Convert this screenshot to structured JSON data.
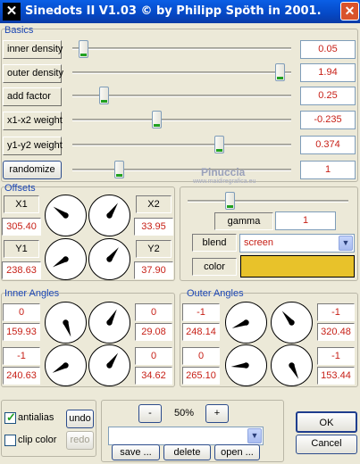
{
  "window": {
    "title": "Sinedots II V1.03 © by Philipp Spöth in 2001.",
    "close_glyph": "✕",
    "app_icon_glyph": "✕"
  },
  "basics": {
    "title": "Basics",
    "sliders": [
      {
        "label": "inner density",
        "value": "0.05",
        "level": 0.03
      },
      {
        "label": "outer density",
        "value": "1.94",
        "level": 0.97
      },
      {
        "label": "add factor",
        "value": "0.25",
        "level": 0.13
      },
      {
        "label": "x1-x2 weight",
        "value": "-0.235",
        "level": 0.38
      },
      {
        "label": "y1-y2 weight",
        "value": "0.374",
        "level": 0.68
      }
    ],
    "randomize": {
      "label": "randomize",
      "value": "1",
      "level": 0.2
    }
  },
  "watermark": {
    "line1": "Pinuccia",
    "line2": "www.maidiregrafica.eu"
  },
  "offsets": {
    "title": "Offsets",
    "x1": {
      "label": "X1",
      "value": "305.40"
    },
    "x2": {
      "label": "X2",
      "value": "33.95"
    },
    "y1": {
      "label": "Y1",
      "value": "238.63"
    },
    "y2": {
      "label": "Y2",
      "value": "37.90"
    }
  },
  "gamma": {
    "label": "gamma",
    "value": "1",
    "level": 0.25
  },
  "blend": {
    "label": "blend",
    "selected": "screen"
  },
  "color": {
    "label": "color",
    "swatch": "#e8c22a"
  },
  "inner_angles": {
    "title": "Inner Angles",
    "items": [
      {
        "sign": "0",
        "value": "159.93"
      },
      {
        "sign": "0",
        "value": "29.08"
      },
      {
        "sign": "-1",
        "value": "240.63"
      },
      {
        "sign": "0",
        "value": "34.62"
      }
    ]
  },
  "outer_angles": {
    "title": "Outer Angles",
    "items": [
      {
        "sign": "-1",
        "value": "248.14"
      },
      {
        "sign": "-1",
        "value": "320.48"
      },
      {
        "sign": "0",
        "value": "265.10"
      },
      {
        "sign": "-1",
        "value": "153.44"
      }
    ]
  },
  "options": {
    "antialias": "antialias",
    "antialias_checked": true,
    "clip_color": "clip color",
    "clip_checked": false,
    "undo": "undo",
    "redo": "redo"
  },
  "presets": {
    "zoom_out": "-",
    "zoom": "50%",
    "zoom_in": "+",
    "selected": "",
    "save": "save ...",
    "delete": "delete",
    "open": "open ..."
  },
  "dialog": {
    "ok": "OK",
    "cancel": "Cancel"
  },
  "colors": {
    "value_text": "#c71f16",
    "section_title": "#1c47b5",
    "titlebar": "#0548c5"
  }
}
